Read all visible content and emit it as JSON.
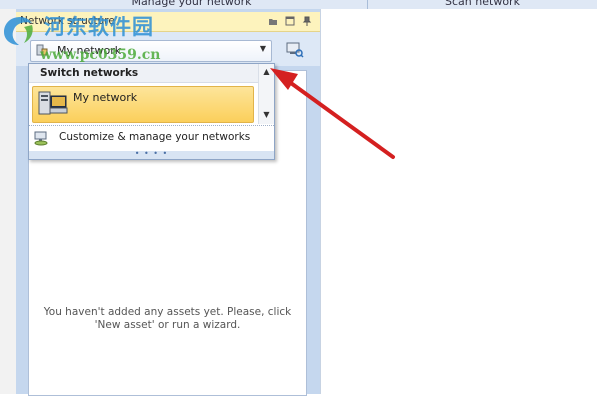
{
  "top_tabs": [
    {
      "label": "Manage your network"
    },
    {
      "label": "Scan network"
    }
  ],
  "panel": {
    "title": "Network structure",
    "header_icons": [
      "folder-icon",
      "window-icon",
      "pin-icon"
    ]
  },
  "network_selector": {
    "value": "My network",
    "icon": "network-icon",
    "dropdown_icon": "chevron-down-icon"
  },
  "scan_button": {
    "icon": "scan-network-icon"
  },
  "dropdown": {
    "section_label": "Switch networks",
    "items": [
      {
        "label": "My network",
        "icon": "network-devices-icon",
        "selected": true
      }
    ],
    "action_label": "Customize & manage your networks",
    "action_icon": "network-settings-icon"
  },
  "empty_message": "You haven't added any assets yet. Please, click 'New asset' or run a wizard.",
  "watermark": {
    "name": "河东软件园",
    "url": "www.pc0359.cn"
  },
  "colors": {
    "panel_header": "#fdf3bd",
    "panel_background": "#c5d7ee",
    "selected_item": "#fbcf5b",
    "annotation_arrow": "#d42020"
  }
}
